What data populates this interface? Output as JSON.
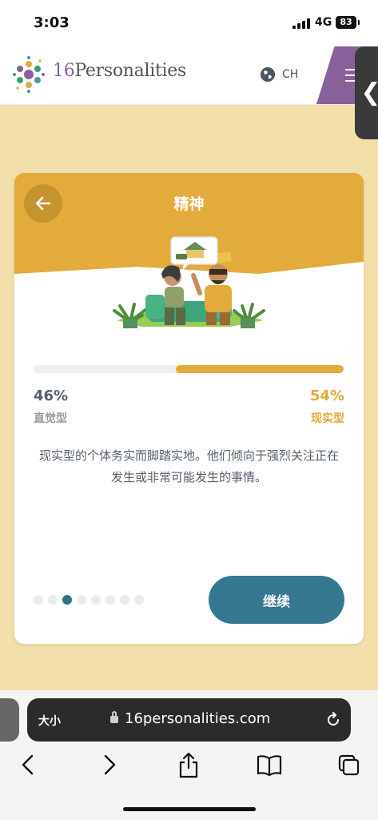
{
  "status_bar": {
    "time": "3:03",
    "network": "4G",
    "battery": "83"
  },
  "header": {
    "logo_number": "16",
    "logo_word": "Personalities",
    "language": "CH"
  },
  "side_tab": {
    "glyph": "❮"
  },
  "card": {
    "title": "精神",
    "progress_fraction": 0.54,
    "left_percent": "46%",
    "left_label": "直觉型",
    "right_percent": "54%",
    "right_label": "现实型",
    "description": "现实型的个体务实而脚踏实地。他们倾向于强烈关注正在发生或非常可能发生的事情。",
    "dots_total": 8,
    "dots_active_index": 2,
    "continue_label": "继续"
  },
  "browser": {
    "text_size_label": "大小",
    "url": "16personalities.com"
  },
  "colors": {
    "accent_yellow": "#e2ab3b",
    "button_teal": "#35788f",
    "brand_purple": "#88619a",
    "page_bg": "#f3dfab"
  },
  "icons": [
    "globe-icon",
    "menu-icon",
    "back-arrow-icon",
    "lock-icon",
    "reload-icon",
    "back-icon",
    "forward-icon",
    "share-icon",
    "bookmarks-icon",
    "tabs-icon"
  ]
}
